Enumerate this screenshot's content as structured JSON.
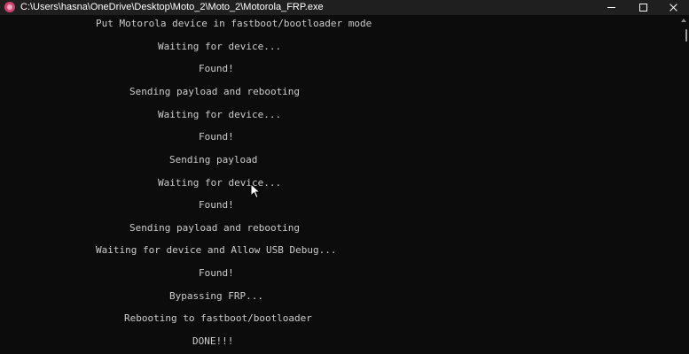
{
  "window": {
    "title": "C:\\Users\\hasna\\OneDrive\\Desktop\\Moto_2\\Moto_2\\Motorola_FRP.exe",
    "icon": "motorola-app-icon",
    "controls": {
      "minimize_icon": "minimize-icon",
      "maximize_icon": "maximize-icon",
      "close_icon": "close-icon"
    }
  },
  "console": {
    "lines": [
      "Put Motorola device in fastboot/bootloader mode",
      "Waiting for device...",
      "Found!",
      "Sending payload and rebooting",
      "Waiting for device...",
      "Found!",
      "Sending payload",
      "Waiting for device...",
      "Found!",
      "Sending payload and rebooting",
      "Waiting for device and Allow USB Debug...",
      "Found!",
      "Bypassing FRP...",
      "Rebooting to fastboot/bootloader",
      "DONE!!!"
    ]
  },
  "colors": {
    "background": "#0c0c0c",
    "text": "#cccccc",
    "titlebar": "#1f1f1f",
    "accent_icon": "#d0426e"
  }
}
